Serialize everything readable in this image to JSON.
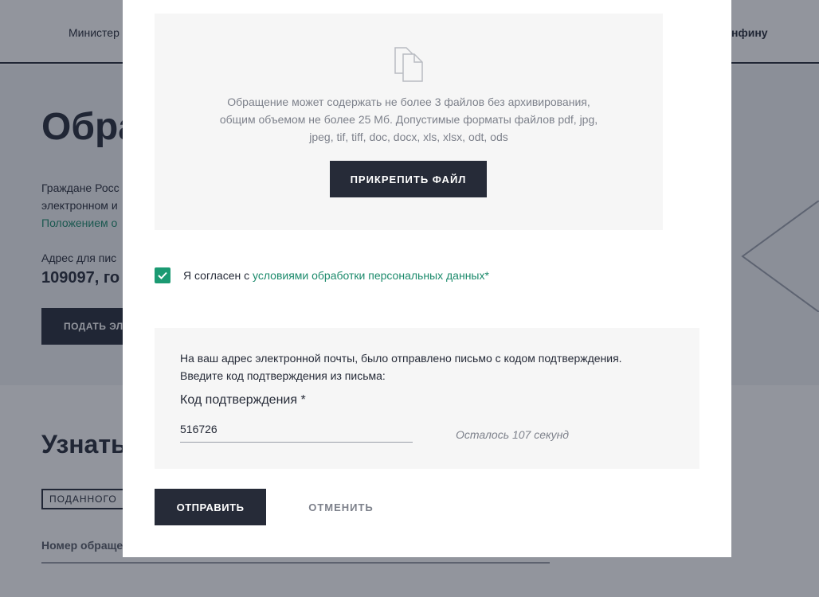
{
  "background": {
    "nav_left": "Министер",
    "nav_right": "нфину",
    "title": "Обра",
    "intro_line1": "Граждане Росс",
    "intro_line2": "электронном и",
    "intro_link": "Положением о",
    "address_label": "Адрес для пис",
    "address_value": "109097, го",
    "submit_button": "ПОДАТЬ ЭЛ",
    "section_title": "Узнать",
    "tab_label": "ПОДАННОГО",
    "field_label": "Номер обраще"
  },
  "upload": {
    "icon": "documents-icon",
    "description_line1": "Обращение может содержать не более 3 файлов без архивирования,",
    "description_line2": "общим объемом не более 25 Мб. Допустимые форматы файлов pdf, jpg,",
    "description_line3": "jpeg, tif, tiff, doc, docx, xls, xlsx, odt, ods",
    "attach_button": "ПРИКРЕПИТЬ ФАЙЛ"
  },
  "consent": {
    "checked": true,
    "text": "Я согласен с ",
    "link": "условиями обработки персональных данных*"
  },
  "confirmation": {
    "message_line1": "На ваш адрес электронной почты, было отправлено письмо с кодом подтверждения.",
    "message_line2": "Введите код подтверждения из письма:",
    "code_label": "Код подтверждения *",
    "code_value": "516726",
    "timer": "Осталось 107 секунд"
  },
  "actions": {
    "submit": "ОТПРАВИТЬ",
    "cancel": "ОТМЕНИТЬ"
  },
  "colors": {
    "primary": "#262b38",
    "accent": "#1b9a72",
    "link": "#1b8a6b",
    "panel": "#f6f6f6",
    "muted_text": "#7d818b"
  }
}
